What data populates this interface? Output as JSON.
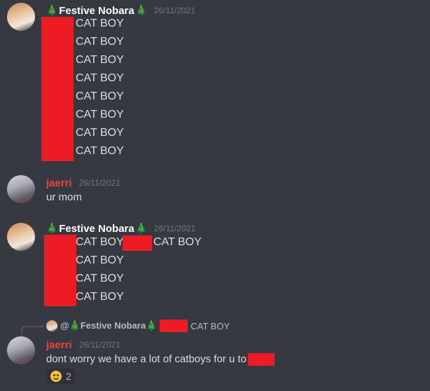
{
  "messages": [
    {
      "author": "Festive Nobara",
      "timestamp": "26/11/2021",
      "lines": [
        "CAT BOY",
        "CAT BOY",
        "CAT BOY",
        "CAT BOY",
        "CAT BOY",
        "CAT BOY",
        "CAT BOY",
        "CAT BOY"
      ]
    },
    {
      "author": "jaerri",
      "timestamp": "26/11/2021",
      "text": "ur mom"
    },
    {
      "author": "Festive Nobara",
      "timestamp": "26/11/2021",
      "lines": [
        "CAT BOY",
        "CAT BOY",
        "CAT BOY",
        "CAT BOY"
      ],
      "inline_extra": "CAT BOY"
    },
    {
      "reply_to": {
        "author": "@🎄Festive Nobara🎄",
        "text": "CAT BOY"
      },
      "author": "jaerri",
      "timestamp": "26/11/2021",
      "text": "dont worry we have a lot of catboys for u to",
      "reaction": {
        "emoji": "smiling-face-icon",
        "count": "2"
      }
    }
  ],
  "colors": {
    "background": "#36393f",
    "redaction": "#ed1c24",
    "jaerri_name": "#ed4245"
  },
  "tree_glyph": "🎄"
}
